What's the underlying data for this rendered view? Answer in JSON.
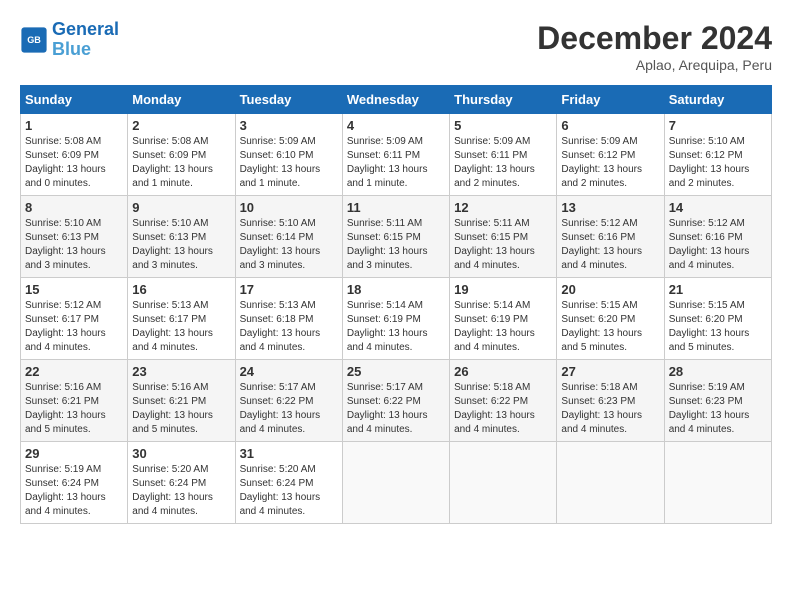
{
  "header": {
    "logo_line1": "General",
    "logo_line2": "Blue",
    "month_title": "December 2024",
    "subtitle": "Aplao, Arequipa, Peru"
  },
  "weekdays": [
    "Sunday",
    "Monday",
    "Tuesday",
    "Wednesday",
    "Thursday",
    "Friday",
    "Saturday"
  ],
  "weeks": [
    [
      {
        "day": "1",
        "sunrise": "5:08 AM",
        "sunset": "6:09 PM",
        "daylight": "13 hours and 0 minutes."
      },
      {
        "day": "2",
        "sunrise": "5:08 AM",
        "sunset": "6:09 PM",
        "daylight": "13 hours and 1 minute."
      },
      {
        "day": "3",
        "sunrise": "5:09 AM",
        "sunset": "6:10 PM",
        "daylight": "13 hours and 1 minute."
      },
      {
        "day": "4",
        "sunrise": "5:09 AM",
        "sunset": "6:11 PM",
        "daylight": "13 hours and 1 minute."
      },
      {
        "day": "5",
        "sunrise": "5:09 AM",
        "sunset": "6:11 PM",
        "daylight": "13 hours and 2 minutes."
      },
      {
        "day": "6",
        "sunrise": "5:09 AM",
        "sunset": "6:12 PM",
        "daylight": "13 hours and 2 minutes."
      },
      {
        "day": "7",
        "sunrise": "5:10 AM",
        "sunset": "6:12 PM",
        "daylight": "13 hours and 2 minutes."
      }
    ],
    [
      {
        "day": "8",
        "sunrise": "5:10 AM",
        "sunset": "6:13 PM",
        "daylight": "13 hours and 3 minutes."
      },
      {
        "day": "9",
        "sunrise": "5:10 AM",
        "sunset": "6:13 PM",
        "daylight": "13 hours and 3 minutes."
      },
      {
        "day": "10",
        "sunrise": "5:10 AM",
        "sunset": "6:14 PM",
        "daylight": "13 hours and 3 minutes."
      },
      {
        "day": "11",
        "sunrise": "5:11 AM",
        "sunset": "6:15 PM",
        "daylight": "13 hours and 3 minutes."
      },
      {
        "day": "12",
        "sunrise": "5:11 AM",
        "sunset": "6:15 PM",
        "daylight": "13 hours and 4 minutes."
      },
      {
        "day": "13",
        "sunrise": "5:12 AM",
        "sunset": "6:16 PM",
        "daylight": "13 hours and 4 minutes."
      },
      {
        "day": "14",
        "sunrise": "5:12 AM",
        "sunset": "6:16 PM",
        "daylight": "13 hours and 4 minutes."
      }
    ],
    [
      {
        "day": "15",
        "sunrise": "5:12 AM",
        "sunset": "6:17 PM",
        "daylight": "13 hours and 4 minutes."
      },
      {
        "day": "16",
        "sunrise": "5:13 AM",
        "sunset": "6:17 PM",
        "daylight": "13 hours and 4 minutes."
      },
      {
        "day": "17",
        "sunrise": "5:13 AM",
        "sunset": "6:18 PM",
        "daylight": "13 hours and 4 minutes."
      },
      {
        "day": "18",
        "sunrise": "5:14 AM",
        "sunset": "6:19 PM",
        "daylight": "13 hours and 4 minutes."
      },
      {
        "day": "19",
        "sunrise": "5:14 AM",
        "sunset": "6:19 PM",
        "daylight": "13 hours and 4 minutes."
      },
      {
        "day": "20",
        "sunrise": "5:15 AM",
        "sunset": "6:20 PM",
        "daylight": "13 hours and 5 minutes."
      },
      {
        "day": "21",
        "sunrise": "5:15 AM",
        "sunset": "6:20 PM",
        "daylight": "13 hours and 5 minutes."
      }
    ],
    [
      {
        "day": "22",
        "sunrise": "5:16 AM",
        "sunset": "6:21 PM",
        "daylight": "13 hours and 5 minutes."
      },
      {
        "day": "23",
        "sunrise": "5:16 AM",
        "sunset": "6:21 PM",
        "daylight": "13 hours and 5 minutes."
      },
      {
        "day": "24",
        "sunrise": "5:17 AM",
        "sunset": "6:22 PM",
        "daylight": "13 hours and 4 minutes."
      },
      {
        "day": "25",
        "sunrise": "5:17 AM",
        "sunset": "6:22 PM",
        "daylight": "13 hours and 4 minutes."
      },
      {
        "day": "26",
        "sunrise": "5:18 AM",
        "sunset": "6:22 PM",
        "daylight": "13 hours and 4 minutes."
      },
      {
        "day": "27",
        "sunrise": "5:18 AM",
        "sunset": "6:23 PM",
        "daylight": "13 hours and 4 minutes."
      },
      {
        "day": "28",
        "sunrise": "5:19 AM",
        "sunset": "6:23 PM",
        "daylight": "13 hours and 4 minutes."
      }
    ],
    [
      {
        "day": "29",
        "sunrise": "5:19 AM",
        "sunset": "6:24 PM",
        "daylight": "13 hours and 4 minutes."
      },
      {
        "day": "30",
        "sunrise": "5:20 AM",
        "sunset": "6:24 PM",
        "daylight": "13 hours and 4 minutes."
      },
      {
        "day": "31",
        "sunrise": "5:20 AM",
        "sunset": "6:24 PM",
        "daylight": "13 hours and 4 minutes."
      },
      null,
      null,
      null,
      null
    ]
  ]
}
